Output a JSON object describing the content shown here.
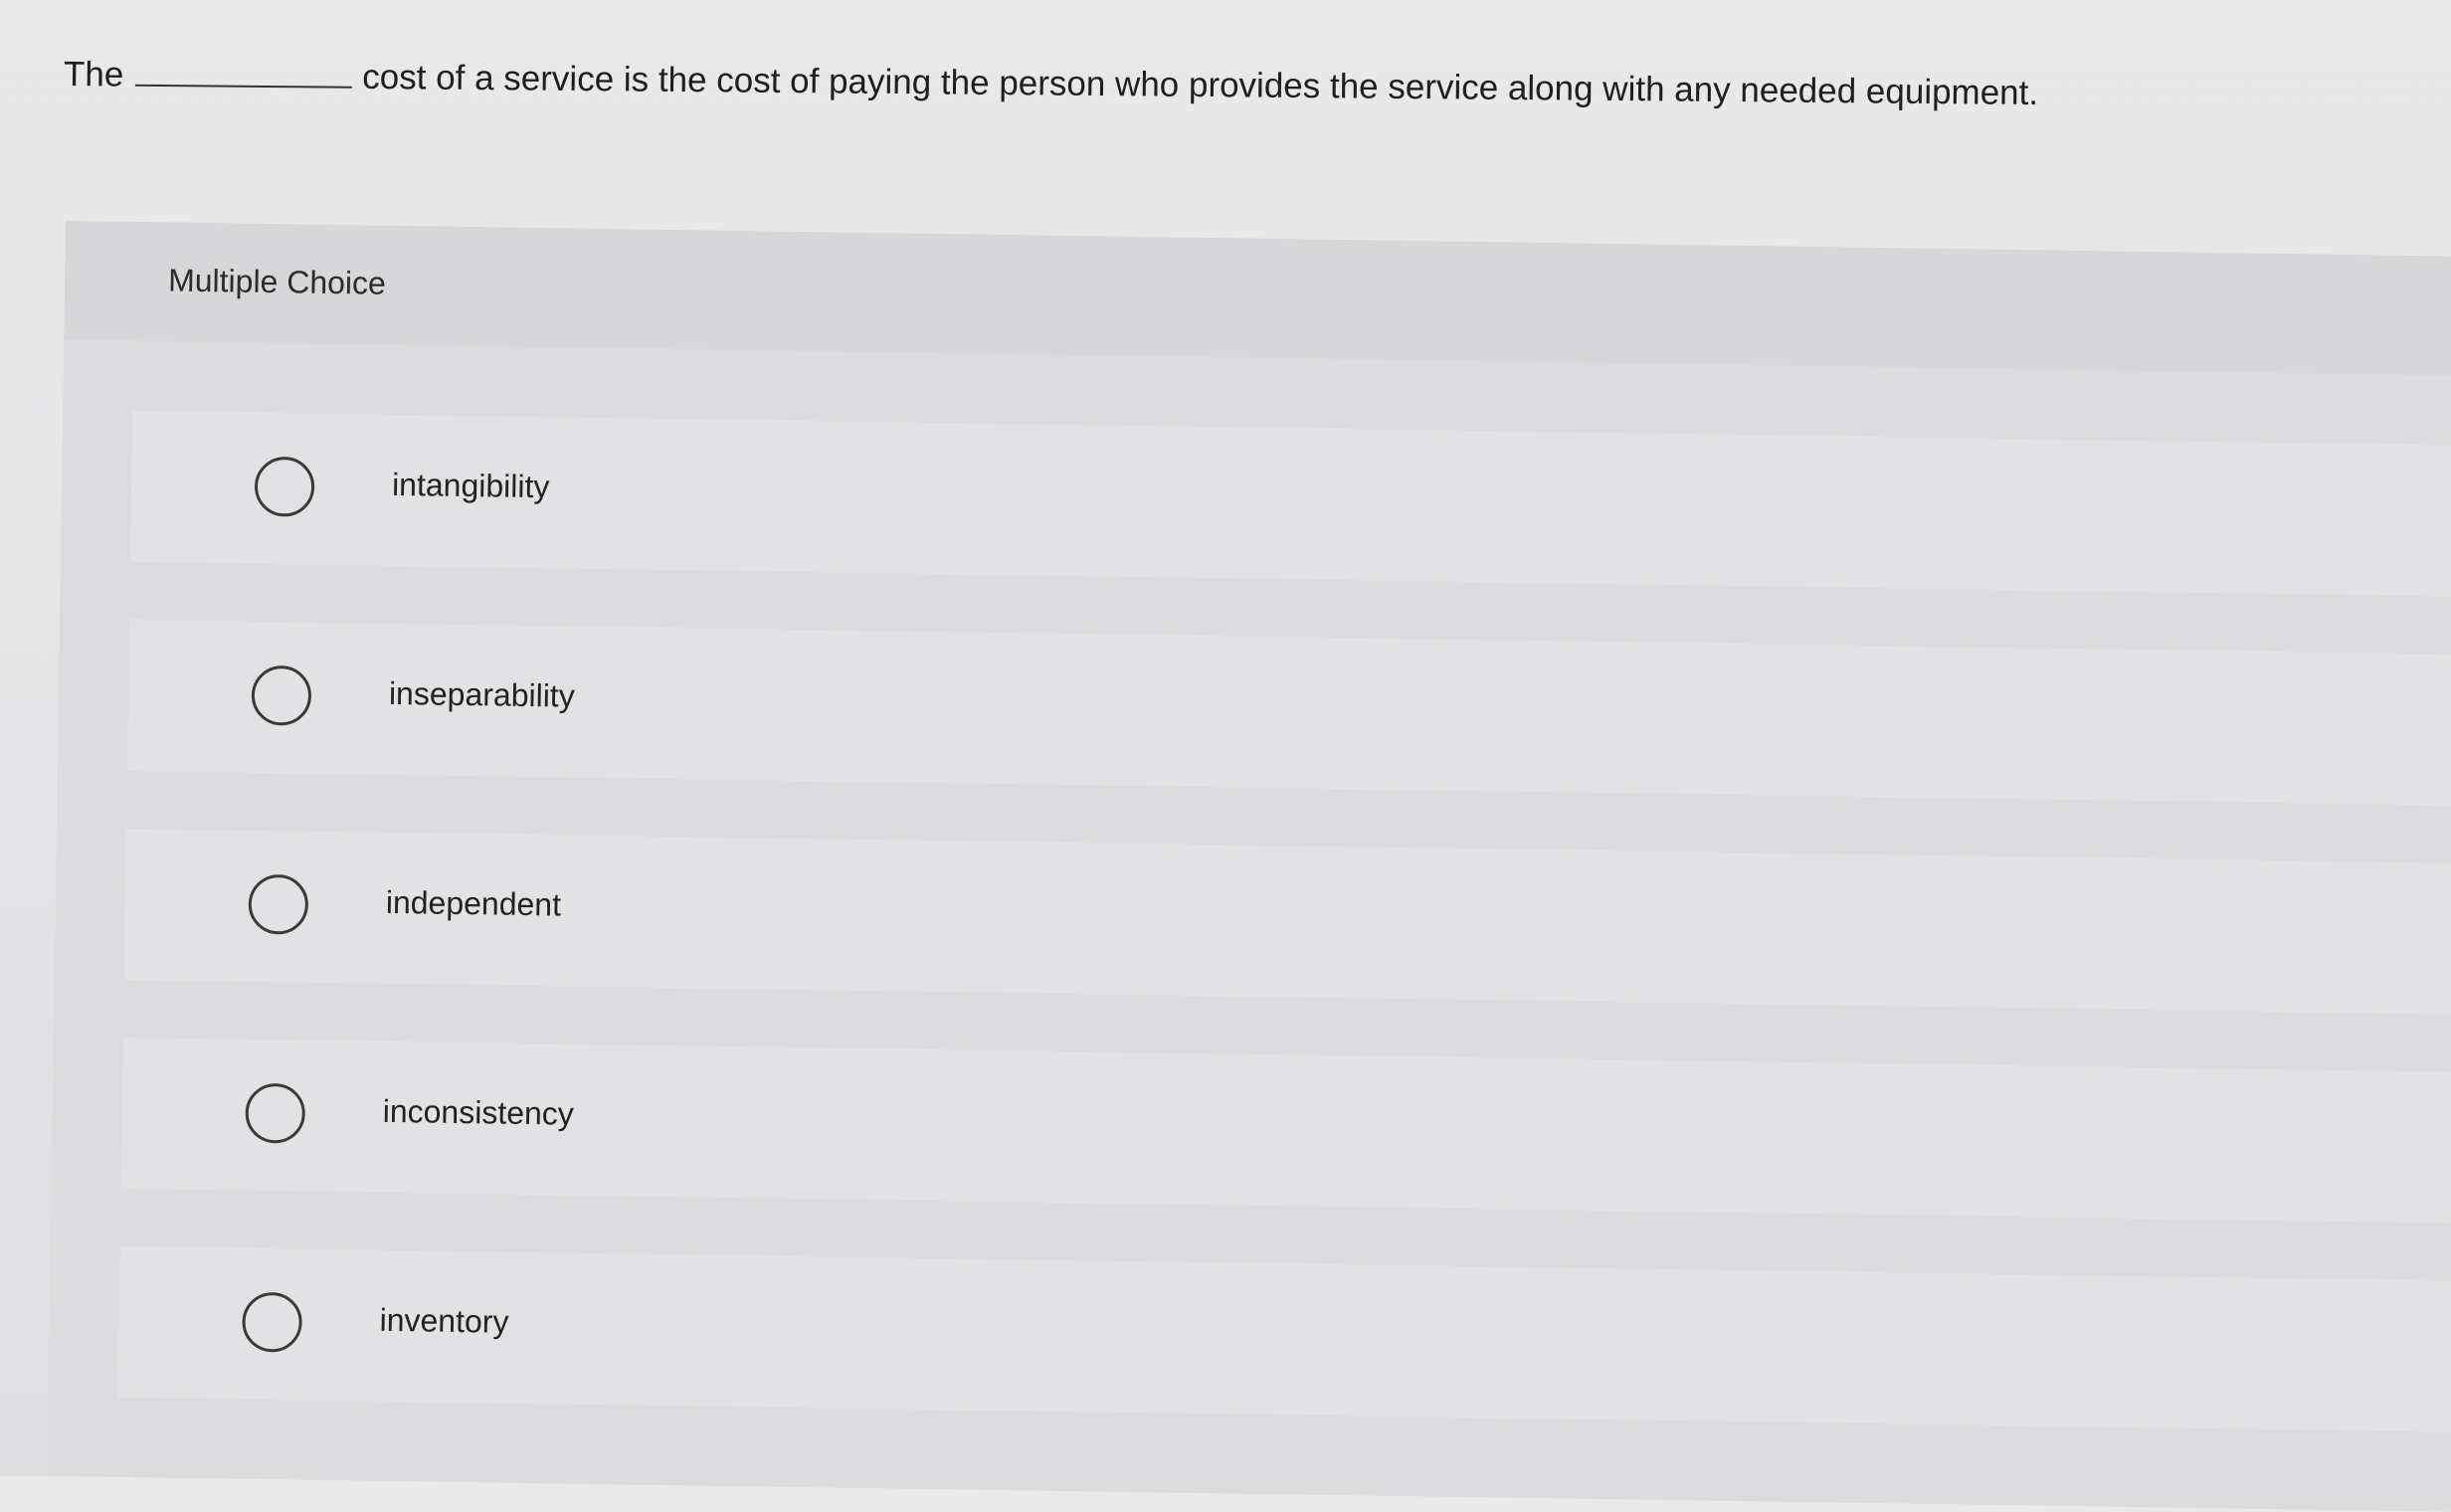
{
  "question": {
    "prefix": "The",
    "suffix": "cost of a service is the cost of paying the person who provides the service along with any needed equipment."
  },
  "card": {
    "title": "Multiple Choice",
    "choices": [
      {
        "label": "intangibility"
      },
      {
        "label": "inseparability"
      },
      {
        "label": "independent"
      },
      {
        "label": "inconsistency"
      },
      {
        "label": "inventory"
      }
    ]
  }
}
